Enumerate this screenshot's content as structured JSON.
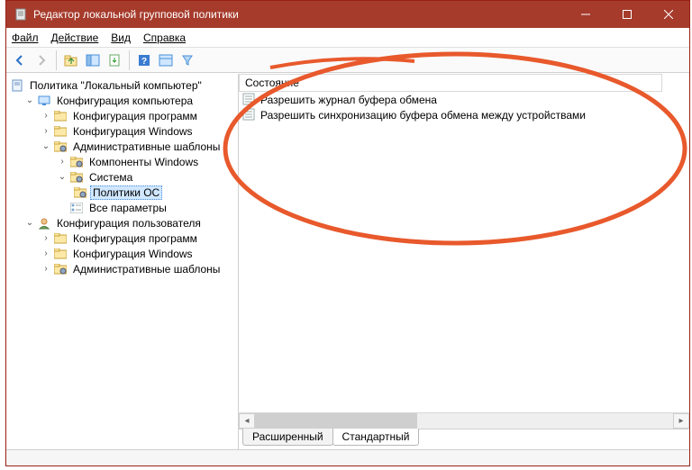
{
  "window": {
    "title": "Редактор локальной групповой политики"
  },
  "menu": {
    "file": "Файл",
    "action": "Действие",
    "view": "Вид",
    "help": "Справка"
  },
  "tree": {
    "root": "Политика \"Локальный компьютер\"",
    "comp_config": "Конфигурация компьютера",
    "soft_config": "Конфигурация программ",
    "win_config": "Конфигурация Windows",
    "admin_templates": "Административные шаблоны",
    "win_components": "Компоненты Windows",
    "system": "Система",
    "os_policies": "Политики ОС",
    "all_params": "Все параметры",
    "user_config": "Конфигурация пользователя",
    "soft_config2": "Конфигурация программ",
    "win_config2": "Конфигурация Windows",
    "admin_templates2": "Административные шаблоны"
  },
  "list": {
    "col_state": "Состояние",
    "item1": "Разрешить журнал буфера обмена",
    "item2": "Разрешить синхронизацию буфера обмена между устройствами"
  },
  "tabs": {
    "extended": "Расширенный",
    "standard": "Стандартный"
  }
}
